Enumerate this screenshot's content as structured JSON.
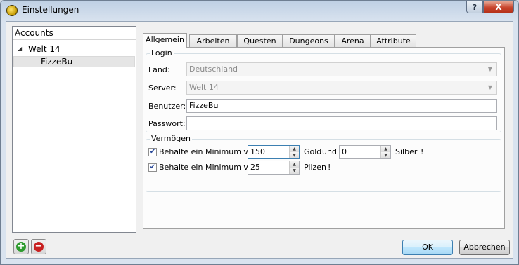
{
  "window": {
    "title": "Einstellungen",
    "help_label": "?",
    "close_label": "X"
  },
  "sidebar": {
    "header": "Accounts",
    "world": "Welt 14",
    "account": "FizzeBu"
  },
  "tabs": [
    {
      "label": "Allgemein",
      "active": true
    },
    {
      "label": "Arbeiten"
    },
    {
      "label": "Questen"
    },
    {
      "label": "Dungeons"
    },
    {
      "label": "Arena"
    },
    {
      "label": "Attribute"
    }
  ],
  "login": {
    "group_title": "Login",
    "land_label": "Land:",
    "land_value": "Deutschland",
    "server_label": "Server:",
    "server_value": "Welt 14",
    "user_label": "Benutzer:",
    "user_value": "FizzeBu",
    "password_label": "Passwort:",
    "password_value": ""
  },
  "wealth": {
    "group_title": "Vermögen",
    "row1": {
      "checked": true,
      "label": "Behalte ein Minimum von",
      "gold_value": "150",
      "gold_label": "Gold",
      "and_label": "und",
      "silver_value": "0",
      "silver_label": "Silber",
      "excl": "!"
    },
    "row2": {
      "checked": true,
      "label": "Behalte ein Minimum von",
      "mushroom_value": "25",
      "mushroom_label": "Pilzen",
      "excl": "!"
    }
  },
  "footer": {
    "ok_label": "OK",
    "cancel_label": "Abbrechen"
  },
  "colors": {
    "add": "#2e9b2e",
    "remove": "#c82020",
    "accent": "#3c7fb1"
  }
}
